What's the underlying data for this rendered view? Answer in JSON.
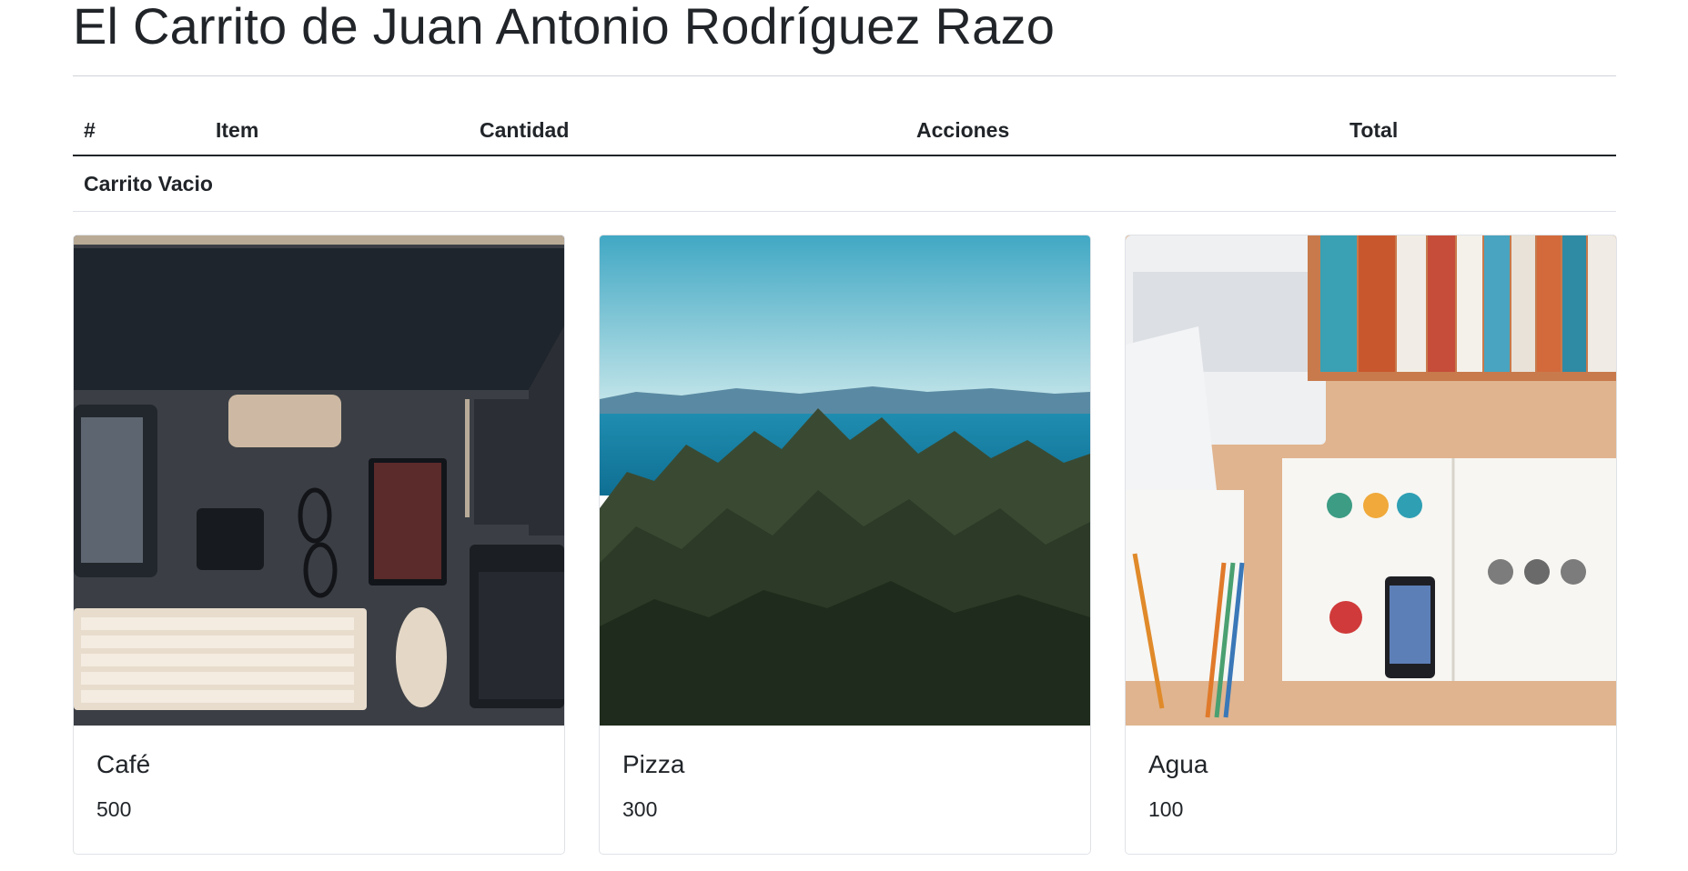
{
  "page": {
    "title": "El Carrito de Juan Antonio Rodríguez Razo"
  },
  "cart": {
    "headers": [
      "#",
      "Item",
      "Cantidad",
      "Acciones",
      "Total"
    ],
    "empty_text": "Carrito Vacio"
  },
  "products": [
    {
      "name": "Café",
      "price": "500",
      "image": "desk-workspace-photo"
    },
    {
      "name": "Pizza",
      "price": "300",
      "image": "forest-lake-photo"
    },
    {
      "name": "Agua",
      "price": "100",
      "image": "books-desk-photo"
    }
  ]
}
